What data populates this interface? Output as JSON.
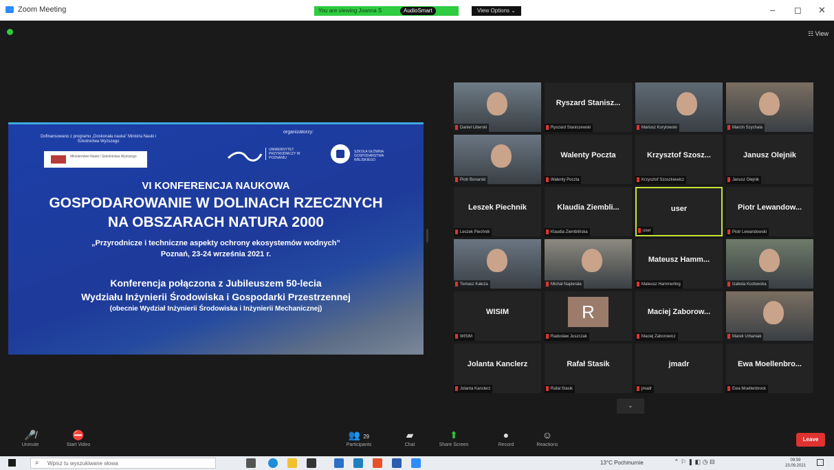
{
  "window": {
    "title": "Zoom Meeting",
    "banner_text": "You are viewing Joanna S",
    "audio_label": "AudioSmart",
    "view_options": "View Options ⌄",
    "minimize": "–",
    "maximize": "◻",
    "close": "✕"
  },
  "meeting": {
    "view_label": "☷ View"
  },
  "slide": {
    "funding_text": "Dofinansowano z programu „Doskonała nauka” Ministra Nauki i Szkolnictwa Wyższego",
    "ministry_text": "Ministerstwo Nauki i Szkolnictwa Wyższego",
    "organizers": "organizatorzy:",
    "university": "UNIWERSYTET PRZYRODNICZY W POZNANIU",
    "sggw": "SZKOŁA GŁÓWNA GOSPODARSTWA WIEJSKIEGO",
    "line1": "VI KONFERENCJA NAUKOWA",
    "line2": "GOSPODAROWANIE W DOLINACH RZECZNYCH",
    "line3": "NA OBSZARACH NATURA 2000",
    "line4": "„Przyrodnicze i techniczne aspekty ochrony ekosystemów wodnych”",
    "line5": "Poznań, 23-24 września 2021 r.",
    "line6": "Konferencja połączona z Jubileuszem 50-lecia",
    "line7": "Wydziału Inżynierii Środowiska i Gospodarki Przestrzennej",
    "line8": "(obecnie Wydział Inżynierii Środowiska i Inżynierii Mechanicznej)"
  },
  "participants": [
    {
      "big": "",
      "label": "Daniel Liberski",
      "video": true
    },
    {
      "big": "Ryszard Stanisz...",
      "label": "Ryszard Staniszewski",
      "video": false
    },
    {
      "big": "",
      "label": "Mariusz Korytowski",
      "video": true
    },
    {
      "big": "",
      "label": "Marcin Szychala",
      "video": true
    },
    {
      "big": "",
      "label": "Piotr Bonarski",
      "video": true
    },
    {
      "big": "Walenty Poczta",
      "label": "Walenty Poczta",
      "video": false
    },
    {
      "big": "Krzysztof Szosz...",
      "label": "Krzysztof Szoszkiewicz",
      "video": false
    },
    {
      "big": "Janusz Olejnik",
      "label": "Janusz Olejnik",
      "video": false
    },
    {
      "big": "Leszek Piechnik",
      "label": "Leszek Piechnik",
      "video": false
    },
    {
      "big": "Klaudia Ziembli...",
      "label": "Klaudia Ziemblińska",
      "video": false
    },
    {
      "big": "user",
      "label": "user",
      "video": false
    },
    {
      "big": "Piotr Lewandow...",
      "label": "Piotr Lewandowski",
      "video": false
    },
    {
      "big": "",
      "label": "Tomasz Kałuża",
      "video": true
    },
    {
      "big": "",
      "label": "Michał Napierała",
      "video": true
    },
    {
      "big": "Mateusz Hamm...",
      "label": "Mateusz Hammerling",
      "video": false
    },
    {
      "big": "",
      "label": "Izabela Kozłowska",
      "video": true
    },
    {
      "big": "WISIM",
      "label": "WISIM",
      "video": false
    },
    {
      "big": "R",
      "label": "Radosław Juszczak",
      "video": false
    },
    {
      "big": "Maciej Zaborow...",
      "label": "Maciej Zaborowicz",
      "video": false
    },
    {
      "big": "",
      "label": "Marek Urbaniak",
      "video": true
    },
    {
      "big": "Jolanta Kanclerz",
      "label": "Jolanta Kanclerz",
      "video": false
    },
    {
      "big": "Rafał Stasik",
      "label": "Rafał Stasik",
      "video": false
    },
    {
      "big": "jmadr",
      "label": "jmadr",
      "video": false
    },
    {
      "big": "Ewa Moellenbro...",
      "label": "Ewa Moellenbrock",
      "video": false
    }
  ],
  "more_button": "⌄",
  "toolbar": {
    "unmute": "Unmute",
    "start_video": "Start Video",
    "participants_count": "29",
    "participants": "Participants",
    "chat": "Chat",
    "share_screen": "Share Screen",
    "record": "Record",
    "reactions": "Reactions",
    "leave": "Leave"
  },
  "taskbar": {
    "search_placeholder": "Wpisz tu wyszukiwane słowa",
    "weather": "13°C Pochmurnie",
    "tray": "⌃ ⚐ ❚ ◧ ◷ ⊟",
    "time": "09:59",
    "date": "23.09.2021"
  },
  "colors": {
    "active_speaker_border": "#c8e63a",
    "share_green": "#2ecc40",
    "leave_red": "#e0322f",
    "slide_blue": "#1e3a9a"
  }
}
